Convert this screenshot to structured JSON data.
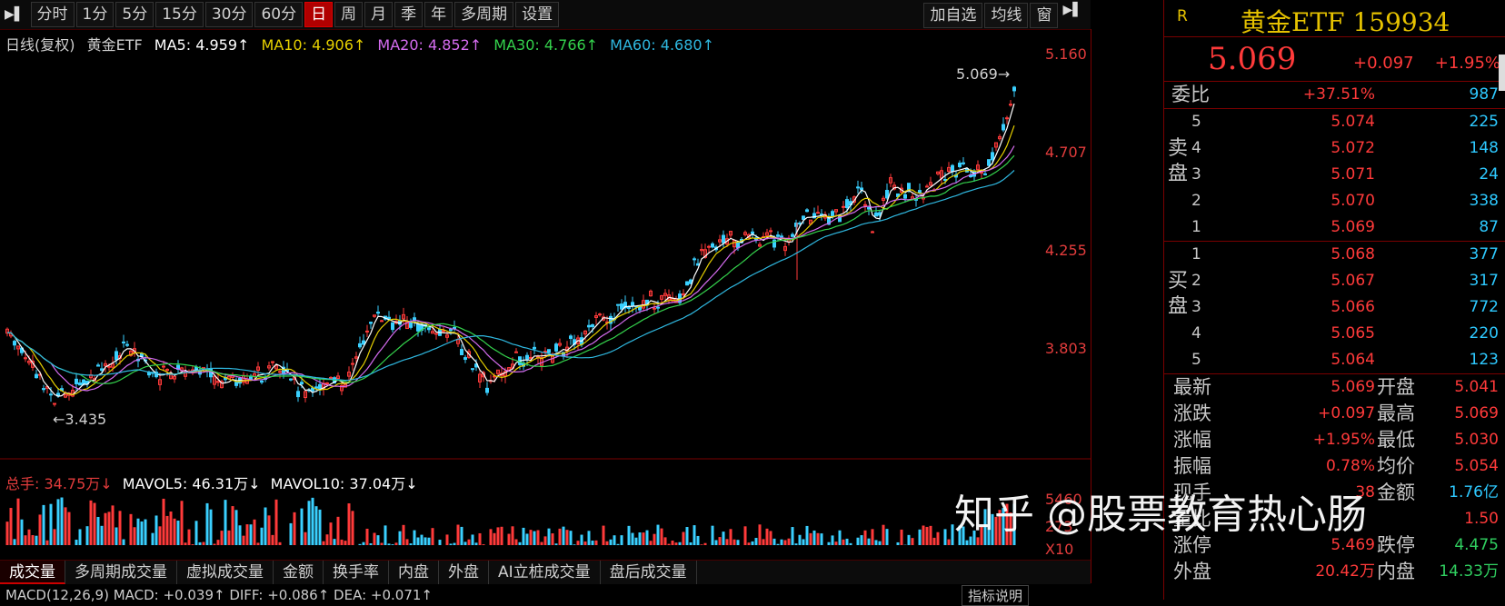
{
  "toolbar": {
    "items": [
      "分时",
      "1分",
      "5分",
      "15分",
      "30分",
      "60分",
      "日",
      "周",
      "月",
      "季",
      "年",
      "多周期",
      "设置"
    ],
    "active_index": 6,
    "right_items": [
      "加自选",
      "均线",
      "窗"
    ]
  },
  "ma_legend": {
    "prefix": "日线(复权)",
    "name": "黄金ETF",
    "ma5": "MA5: 4.959↑",
    "ma10": "MA10: 4.906↑",
    "ma20": "MA20: 4.852↑",
    "ma30": "MA30: 4.766↑",
    "ma60": "MA60: 4.680↑",
    "colors": {
      "name": "#d0d0d0",
      "ma5": "#ffffff",
      "ma10": "#e6d000",
      "ma20": "#d56cf0",
      "ma30": "#34d24c",
      "ma60": "#2fb8e0"
    }
  },
  "price_axis": [
    "5.160",
    "4.707",
    "4.255",
    "3.803"
  ],
  "annotations": {
    "high": "5.069",
    "low": "3.435"
  },
  "volume_legend": {
    "total": "总手: 34.75万↓",
    "mavol5": "MAVOL5: 46.31万↓",
    "mavol10": "MAVOL10: 37.04万↓"
  },
  "volume_axis": [
    "5460",
    "273",
    "X10"
  ],
  "bottom_tabs": [
    "成交量",
    "多周期成交量",
    "虚拟成交量",
    "金额",
    "换手率",
    "内盘",
    "外盘",
    "AI立桩成交量",
    "盘后成交量"
  ],
  "bottom_active": 0,
  "macd_text": "MACD(12,26,9) MACD: +0.039↑ DIFF: +0.086↑ DEA: +0.071↑",
  "macd_button": "指标说明",
  "quote": {
    "badge": "R",
    "title": "黄金ETF 159934",
    "price": "5.069",
    "change": "+0.097",
    "pct": "+1.95%",
    "weibi_label": "委比",
    "weibi_value": "+37.51%",
    "weibi_qty": "987",
    "sell_label": "卖盘",
    "buy_label": "买盘",
    "sell": [
      {
        "idx": "5",
        "price": "5.074",
        "qty": "225"
      },
      {
        "idx": "4",
        "price": "5.072",
        "qty": "148"
      },
      {
        "idx": "3",
        "price": "5.071",
        "qty": "24"
      },
      {
        "idx": "2",
        "price": "5.070",
        "qty": "338"
      },
      {
        "idx": "1",
        "price": "5.069",
        "qty": "87"
      }
    ],
    "buy": [
      {
        "idx": "1",
        "price": "5.068",
        "qty": "377"
      },
      {
        "idx": "2",
        "price": "5.067",
        "qty": "317"
      },
      {
        "idx": "3",
        "price": "5.066",
        "qty": "772"
      },
      {
        "idx": "4",
        "price": "5.065",
        "qty": "220"
      },
      {
        "idx": "5",
        "price": "5.064",
        "qty": "123"
      }
    ],
    "stats": [
      {
        "l1": "最新",
        "v1": "5.069",
        "l2": "开盘",
        "v2": "5.041",
        "c2": "red"
      },
      {
        "l1": "涨跌",
        "v1": "+0.097",
        "l2": "最高",
        "v2": "5.069",
        "c2": "red"
      },
      {
        "l1": "涨幅",
        "v1": "+1.95%",
        "l2": "最低",
        "v2": "5.030",
        "c2": "red"
      },
      {
        "l1": "振幅",
        "v1": "0.78%",
        "l2": "均价",
        "v2": "5.054",
        "c2": "red"
      },
      {
        "l1": "现手",
        "v1": "38",
        "l2": "金额",
        "v2": "1.76亿",
        "c2": "blue"
      },
      {
        "l1": "量比",
        "v1": "",
        "l2": "",
        "v2": "1.50",
        "c2": "red"
      },
      {
        "l1": "涨停",
        "v1": "5.469",
        "l2": "跌停",
        "v2": "4.475",
        "c2": "green"
      },
      {
        "l1": "外盘",
        "v1": "20.42万",
        "l2": "内盘",
        "v2": "14.33万",
        "c2": "green"
      }
    ]
  },
  "watermark": "知乎 @股票教育热心肠"
}
